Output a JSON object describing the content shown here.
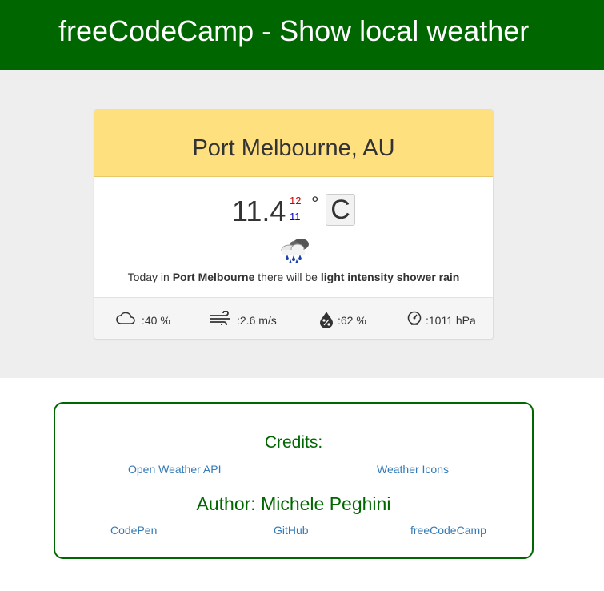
{
  "header": {
    "title": "freeCodeCamp - Show local weather"
  },
  "weather": {
    "location": "Port Melbourne, AU",
    "temperature": "11.4",
    "temp_max": "12",
    "temp_min": "11",
    "degree_symbol": "°",
    "unit": "C",
    "condition_icon": "shower-rain-icon",
    "description": {
      "prefix": "Today in ",
      "city": "Port Melbourne",
      "middle": " there will be ",
      "condition": "light intensity shower rain"
    },
    "stats": {
      "cloudiness": ":40 %",
      "wind": ":2.6 m/s",
      "humidity": ":62 %",
      "pressure": ":1011 hPa"
    }
  },
  "credits": {
    "heading": "Credits:",
    "links": [
      "Open Weather API",
      "Weather Icons"
    ],
    "author_heading": "Author: Michele Peghini",
    "author_links": [
      "CodePen",
      "GitHub",
      "freeCodeCamp"
    ]
  },
  "colors": {
    "header_bg": "#006600",
    "card_header_bg": "#ffe07f",
    "link": "#337ab7",
    "temp_max": "#cc0000",
    "temp_min": "#0000cc"
  }
}
